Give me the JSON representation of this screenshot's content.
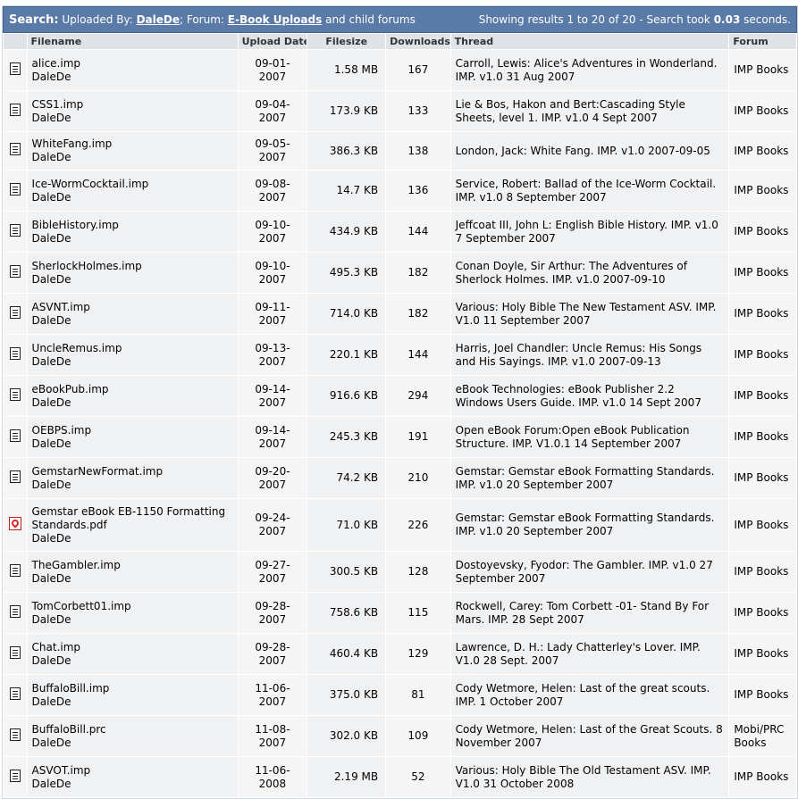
{
  "search": {
    "label": "Search:",
    "uploaded_by_text": "Uploaded By:",
    "uploader": "DaleDe",
    "forum_sep": "; Forum:",
    "forum": "E-Book Uploads",
    "forum_suffix": "and child forums",
    "results_prefix": "Showing results 1 to 20 of 20 - Search took",
    "time": "0.03",
    "time_suffix": "seconds."
  },
  "columns": [
    "Filename",
    "Upload Date",
    "Filesize",
    "Downloads",
    "Thread",
    "Forum"
  ],
  "rows": [
    {
      "icon": "doc",
      "file": "alice.imp",
      "user": "DaleDe",
      "date": "09-01-2007",
      "size": "1.58 MB",
      "downloads": "167",
      "thread": "Carroll, Lewis: Alice's Adventures in Wonderland. IMP. v1.0 31 Aug 2007",
      "forum": "IMP Books"
    },
    {
      "icon": "doc",
      "file": "CSS1.imp",
      "user": "DaleDe",
      "date": "09-04-2007",
      "size": "173.9 KB",
      "downloads": "133",
      "thread": "Lie & Bos, Hakon and Bert:Cascading Style Sheets, level 1. IMP. v1.0 4 Sept 2007",
      "forum": "IMP Books"
    },
    {
      "icon": "doc",
      "file": "WhiteFang.imp",
      "user": "DaleDe",
      "date": "09-05-2007",
      "size": "386.3 KB",
      "downloads": "138",
      "thread": "London, Jack: White Fang. IMP. v1.0 2007-09-05",
      "forum": "IMP Books"
    },
    {
      "icon": "doc",
      "file": "Ice-WormCocktail.imp",
      "user": "DaleDe",
      "date": "09-08-2007",
      "size": "14.7 KB",
      "downloads": "136",
      "thread": "Service, Robert: Ballad of the Ice-Worm Cocktail. IMP. v1.0 8 September 2007",
      "forum": "IMP Books"
    },
    {
      "icon": "doc",
      "file": "BibleHistory.imp",
      "user": "DaleDe",
      "date": "09-10-2007",
      "size": "434.9 KB",
      "downloads": "144",
      "thread": "Jeffcoat III, John L: English Bible History. IMP. v1.0 7 September 2007",
      "forum": "IMP Books"
    },
    {
      "icon": "doc",
      "file": "SherlockHolmes.imp",
      "user": "DaleDe",
      "date": "09-10-2007",
      "size": "495.3 KB",
      "downloads": "182",
      "thread": "Conan Doyle, Sir Arthur: The Adventures of Sherlock Holmes. IMP. v1.0 2007-09-10",
      "forum": "IMP Books"
    },
    {
      "icon": "doc",
      "file": "ASVNT.imp",
      "user": "DaleDe",
      "date": "09-11-2007",
      "size": "714.0 KB",
      "downloads": "182",
      "thread": "Various: Holy Bible The New Testament ASV. IMP. V1.0 11 September 2007",
      "forum": "IMP Books"
    },
    {
      "icon": "doc",
      "file": "UncleRemus.imp",
      "user": "DaleDe",
      "date": "09-13-2007",
      "size": "220.1 KB",
      "downloads": "144",
      "thread": "Harris, Joel Chandler: Uncle Remus: His Songs and His Sayings. IMP. v1.0 2007-09-13",
      "forum": "IMP Books"
    },
    {
      "icon": "doc",
      "file": "eBookPub.imp",
      "user": "DaleDe",
      "date": "09-14-2007",
      "size": "916.6 KB",
      "downloads": "294",
      "thread": "eBook Technologies: eBook Publisher 2.2 Windows Users Guide. IMP. v1.0 14 Sept 2007",
      "forum": "IMP Books"
    },
    {
      "icon": "doc",
      "file": "OEBPS.imp",
      "user": "DaleDe",
      "date": "09-14-2007",
      "size": "245.3 KB",
      "downloads": "191",
      "thread": "Open eBook Forum:Open eBook Publication Structure. IMP. V1.0.1 14 September 2007",
      "forum": "IMP Books"
    },
    {
      "icon": "doc",
      "file": "GemstarNewFormat.imp",
      "user": "DaleDe",
      "date": "09-20-2007",
      "size": "74.2 KB",
      "downloads": "210",
      "thread": "Gemstar: Gemstar eBook Formatting Standards. IMP. v1.0 20 September 2007",
      "forum": "IMP Books"
    },
    {
      "icon": "pdf",
      "file": "Gemstar eBook EB-1150 Formatting Standards.pdf",
      "user": "DaleDe",
      "date": "09-24-2007",
      "size": "71.0 KB",
      "downloads": "226",
      "thread": "Gemstar: Gemstar eBook Formatting Standards. IMP. v1.0 20 September 2007",
      "forum": "IMP Books"
    },
    {
      "icon": "doc",
      "file": "TheGambler.imp",
      "user": "DaleDe",
      "date": "09-27-2007",
      "size": "300.5 KB",
      "downloads": "128",
      "thread": "Dostoyevsky, Fyodor: The Gambler. IMP. v1.0 27 September 2007",
      "forum": "IMP Books"
    },
    {
      "icon": "doc",
      "file": "TomCorbett01.imp",
      "user": "DaleDe",
      "date": "09-28-2007",
      "size": "758.6 KB",
      "downloads": "115",
      "thread": "Rockwell, Carey: Tom Corbett -01- Stand By For Mars. IMP. 28 Sept 2007",
      "forum": "IMP Books"
    },
    {
      "icon": "doc",
      "file": "Chat.imp",
      "user": "DaleDe",
      "date": "09-28-2007",
      "size": "460.4 KB",
      "downloads": "129",
      "thread": "Lawrence, D. H.: Lady Chatterley's Lover. IMP. V1.0 28 Sept. 2007",
      "forum": "IMP Books"
    },
    {
      "icon": "doc",
      "file": "BuffaloBill.imp",
      "user": "DaleDe",
      "date": "11-06-2007",
      "size": "375.0 KB",
      "downloads": "81",
      "thread": "Cody Wetmore, Helen: Last of the great scouts. IMP. 1 October 2007",
      "forum": "IMP Books"
    },
    {
      "icon": "doc",
      "file": "BuffaloBill.prc",
      "user": "DaleDe",
      "date": "11-08-2007",
      "size": "302.0 KB",
      "downloads": "109",
      "thread": "Cody Wetmore, Helen: Last of the Great Scouts. 8 November 2007",
      "forum": "Mobi/PRC Books"
    },
    {
      "icon": "doc",
      "file": "ASVOT.imp",
      "user": "DaleDe",
      "date": "11-06-2008",
      "size": "2.19 MB",
      "downloads": "52",
      "thread": "Various: Holy Bible The Old Testament ASV. IMP. V1.0 31 October 2008",
      "forum": "IMP Books"
    }
  ]
}
